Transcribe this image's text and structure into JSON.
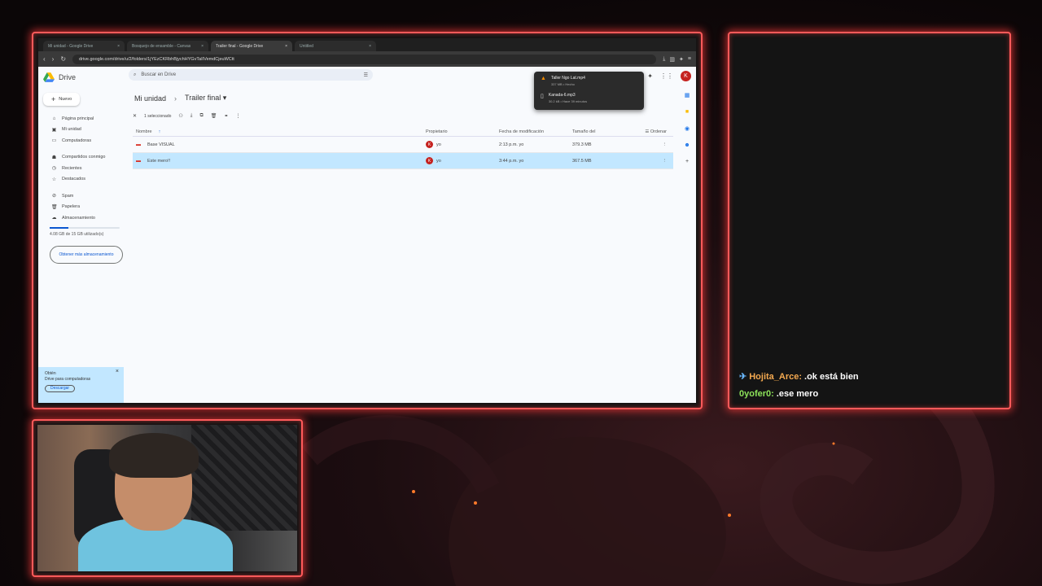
{
  "browser": {
    "tabs": [
      {
        "label": "Mi unidad - Google Drive",
        "active": false
      },
      {
        "label": "Bosquejo de ensamble - Canvas",
        "active": false
      },
      {
        "label": "Trailer final - Google Drive",
        "active": true
      },
      {
        "label": "Untitled",
        "active": false
      }
    ],
    "url": "drive.google.com/drive/u/2/folders/1jYEzCKRbhBjychHYGvTaIIVemdCjeuWCtt"
  },
  "drive": {
    "logo_text": "Drive",
    "new_label": "Nuevo",
    "search_placeholder": "Buscar en Drive",
    "nav": [
      {
        "icon": "home-icon",
        "glyph": "⌂",
        "label": "Página principal"
      },
      {
        "icon": "my-drive-icon",
        "glyph": "▣",
        "label": "Mi unidad"
      },
      {
        "icon": "computer-icon",
        "glyph": "▭",
        "label": "Computadoras"
      },
      {
        "icon": "shared-icon",
        "glyph": "☗",
        "label": "Compartidos conmigo"
      },
      {
        "icon": "clock-icon",
        "glyph": "◷",
        "label": "Recientes"
      },
      {
        "icon": "star-icon",
        "glyph": "☆",
        "label": "Destacados"
      },
      {
        "icon": "spam-icon",
        "glyph": "⊘",
        "label": "Spam"
      },
      {
        "icon": "trash-icon",
        "glyph": "🗑",
        "label": "Papelera"
      },
      {
        "icon": "cloud-icon",
        "glyph": "☁",
        "label": "Almacenamiento"
      }
    ],
    "storage": {
      "used_text": "4.08 GB de 15 GB utilizado(s)",
      "used_fraction": 0.27
    },
    "more_storage_label": "Obtener más almacenamiento",
    "promo": {
      "title": "Obtén",
      "text": "Drive para computadoras",
      "button": "Descargar"
    },
    "breadcrumb": {
      "parent": "Mi unidad",
      "current": "Trailer final"
    },
    "selection": {
      "label": "1 seleccionado"
    },
    "columns": {
      "name": "Nombre",
      "owner": "Propietario",
      "modified": "Fecha de modificación",
      "size": "Tamaño del",
      "sort": "Ordenar"
    },
    "rows": [
      {
        "name": "Base VISUAL",
        "owner": "yo",
        "modified": "2:13 p.m. yo",
        "size": "379.3 MB",
        "selected": false
      },
      {
        "name": "Este mero!!",
        "owner": "yo",
        "modified": "3:44 p.m. yo",
        "size": "367.5 MB",
        "selected": true
      }
    ],
    "account_initial": "K"
  },
  "downloads": [
    {
      "name": "Taller Ngo Lat.mp4",
      "meta": "337 MB • Hecho"
    },
    {
      "name": "Kanada-6.mp3",
      "meta": "30.2 kB • Hace 39 minutos"
    }
  ],
  "chat": [
    {
      "user": "Hojita_Arce:",
      "message": ".ok está bien",
      "badge": "✈"
    },
    {
      "user": "0yofer0:",
      "message": ".ese mero",
      "badge": ""
    }
  ],
  "colors": {
    "frame_glow": "#ff5a5a",
    "selected_row": "#c2e7ff",
    "drive_blue": "#0b57d0"
  }
}
